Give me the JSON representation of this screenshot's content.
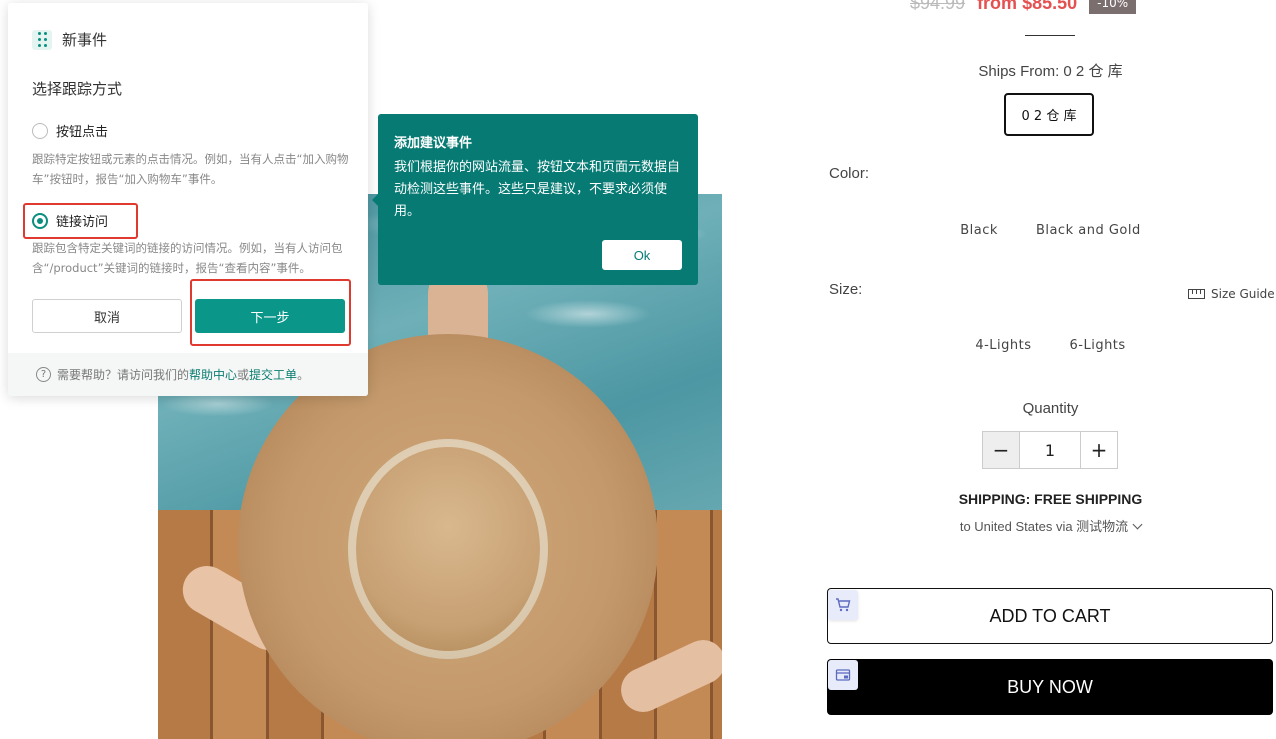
{
  "product": {
    "price_old": "$94.99",
    "price_new": "from $85.50",
    "discount": "-10%",
    "ships_from_label": "Ships From:",
    "ships_from_value": "0 2 仓 库",
    "warehouse_option": "0 2 仓 库",
    "color_label": "Color:",
    "colors": [
      "Black",
      "Black and Gold"
    ],
    "size_label": "Size:",
    "size_guide": "Size Guide",
    "sizes": [
      "4-Lights",
      "6-Lights"
    ],
    "quantity_label": "Quantity",
    "quantity": "1",
    "qty_minus": "−",
    "qty_plus": "+",
    "shipping_title": "SHIPPING: FREE SHIPPING",
    "shipping_sub": "to United States via 测试物流",
    "add_to_cart": "ADD TO CART",
    "buy_now": "BUY NOW"
  },
  "dialog": {
    "title": "新事件",
    "subtitle": "选择跟踪方式",
    "option1_label": "按钮点击",
    "option1_desc": "跟踪特定按钮或元素的点击情况。例如，当有人点击“加入购物车”按钮时，报告“加入购物车”事件。",
    "option2_label": "链接访问",
    "option2_desc": "跟踪包含特定关键词的链接的访问情况。例如，当有人访问包含“/product”关键词的链接时，报告“查看内容”事件。",
    "selected_option": "option2",
    "cancel": "取消",
    "next": "下一步",
    "footer_prefix": "需要帮助？请访问我们的",
    "footer_link1": "帮助中心",
    "footer_or": "或",
    "footer_link2": "提交工单",
    "footer_end": "。",
    "help_glyph": "?"
  },
  "popover": {
    "title": "添加建议事件",
    "body": "我们根据你的网站流量、按钮文本和页面元数据自动检测这些事件。这些只是建议，不要求必须使用。",
    "ok": "Ok"
  },
  "colors": {
    "teal": "#0a9688",
    "popover_bg": "#067a73",
    "highlight": "#e03a30",
    "price_red": "#e55050"
  },
  "icons": {
    "drag": "drag-handle-icon",
    "help": "help-circle-icon",
    "ruler": "ruler-icon",
    "cart": "cart-icon",
    "card": "credit-card-icon",
    "chevron": "chevron-down-icon"
  }
}
